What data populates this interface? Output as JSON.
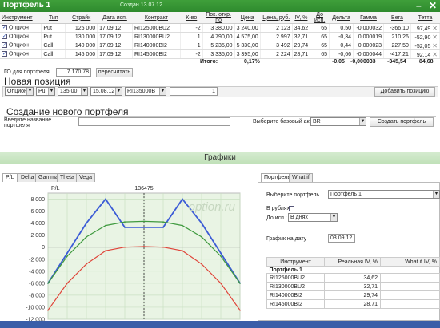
{
  "window": {
    "title": "Портфель 1",
    "created": "Создан 13.07.12",
    "minimize": "–",
    "close": "✕"
  },
  "positions_table": {
    "headers": [
      "Инструмент",
      "Тип",
      "Страйк",
      "Дата исп.",
      "Контракт",
      "К-во",
      "Пок. откр. по",
      "Цена",
      "Цена, руб.",
      "IV, %",
      "До исп.",
      "Дельта",
      "Гамма",
      "Вега",
      "Тетта"
    ],
    "rows": [
      {
        "instrument": "Опцион",
        "type": "Put",
        "strike": "125 000",
        "date": "17.09.12",
        "contract": "RI125000BU2",
        "qty": "-2",
        "open": "3 380,00",
        "price": "3 240,00",
        "price_rub": "2 123",
        "iv": "34,62",
        "days": "65",
        "delta": "0,50",
        "gamma": "-0,000032",
        "vega": "-366,10",
        "theta": "97,49"
      },
      {
        "instrument": "Опцион",
        "type": "Put",
        "strike": "130 000",
        "date": "17.09.12",
        "contract": "RI130000BU2",
        "qty": "1",
        "open": "4 790,00",
        "price": "4 575,00",
        "price_rub": "2 997",
        "iv": "32,71",
        "days": "65",
        "delta": "-0,34",
        "gamma": "0,000019",
        "vega": "210,26",
        "theta": "-52,90"
      },
      {
        "instrument": "Опцион",
        "type": "Call",
        "strike": "140 000",
        "date": "17.09.12",
        "contract": "RI140000BI2",
        "qty": "1",
        "open": "5 235,00",
        "price": "5 330,00",
        "price_rub": "3 492",
        "iv": "29,74",
        "days": "65",
        "delta": "0,44",
        "gamma": "0,000023",
        "vega": "227,50",
        "theta": "-52,05"
      },
      {
        "instrument": "Опцион",
        "type": "Call",
        "strike": "145 000",
        "date": "17.09.12",
        "contract": "RI145000BI2",
        "qty": "-2",
        "open": "3 335,00",
        "price": "3 395,00",
        "price_rub": "2 224",
        "iv": "28,71",
        "days": "65",
        "delta": "-0,66",
        "gamma": "-0,000044",
        "vega": "-417,21",
        "theta": "92,14"
      }
    ],
    "totals": {
      "label": "Итого:",
      "pnl": "0,17%",
      "delta": "-0,05",
      "gamma": "-0,000033",
      "vega": "-345,54",
      "theta": "84,68"
    }
  },
  "go": {
    "label": "ГО для портфеля:",
    "value": "7 170,78",
    "button": "пересчитать"
  },
  "new_position": {
    "title": "Новая позиция",
    "instrument": "Опцион",
    "type": "Pu",
    "strike": "135 00",
    "date": "15.08.12",
    "contract": "RI135000B",
    "qty": "1",
    "add_button": "Добавить позицию"
  },
  "new_portfolio": {
    "title": "Создание нового портфеля",
    "name_label": "Введите название портфеля",
    "asset_label": "Выберите базовый актив",
    "asset_value": "BR",
    "create_button": "Создать портфель"
  },
  "charts_header": "Графики",
  "chart_tabs": [
    "P/L",
    "Delta",
    "Gamma",
    "Theta",
    "Vega"
  ],
  "chart_data": {
    "type": "line",
    "title": "P/L",
    "marker_label": "136475",
    "watermark": "option.ru",
    "ylim": [
      -12000,
      9000
    ],
    "yticks": [
      8000,
      6000,
      4000,
      2000,
      0,
      -2000,
      -4000,
      -6000,
      -8000,
      -10000,
      -12000
    ],
    "ytick_labels": [
      "8 000",
      "6 000",
      "4 000",
      "2 000",
      "0",
      "-2 000",
      "-4 000",
      "-6 000",
      "-8 000",
      "-10 000",
      "-12 000"
    ],
    "x": [
      0,
      1,
      2,
      3,
      4,
      5,
      6,
      7,
      8,
      9,
      10
    ],
    "marker_x": 5,
    "series": [
      {
        "color": "#3b5bd6",
        "values": [
          -6000,
          -1000,
          4000,
          8000,
          3300,
          3300,
          3300,
          8000,
          4000,
          -1000,
          -6000
        ]
      },
      {
        "color": "#3f9a3f",
        "values": [
          -6000,
          -1500,
          1700,
          3600,
          4200,
          4300,
          4200,
          3600,
          1700,
          -1500,
          -6000
        ]
      },
      {
        "color": "#e0453a",
        "values": [
          -10500,
          -6000,
          -2800,
          -600,
          0,
          100,
          0,
          -600,
          -2800,
          -6000,
          -10500
        ]
      }
    ]
  },
  "right_panel": {
    "tabs": [
      "Портфель",
      "What if"
    ],
    "select_label": "Выберите портфель",
    "select_value": "Портфель 1",
    "rub_label": "В рублях:",
    "until_label": "До исп.:",
    "until_value": "В днях",
    "date_label": "График на дату",
    "date_value": "03.09.12",
    "iv_table": {
      "headers": [
        "Инструмент",
        "Реальная IV, %",
        "What if IV, %"
      ],
      "group": "Портфель 1",
      "rows": [
        {
          "name": "RI125000BU2",
          "iv": "34,62"
        },
        {
          "name": "RI130000BU2",
          "iv": "32,71"
        },
        {
          "name": "RI140000BI2",
          "iv": "29,74"
        },
        {
          "name": "RI145000BI2",
          "iv": "28,71"
        }
      ]
    }
  }
}
